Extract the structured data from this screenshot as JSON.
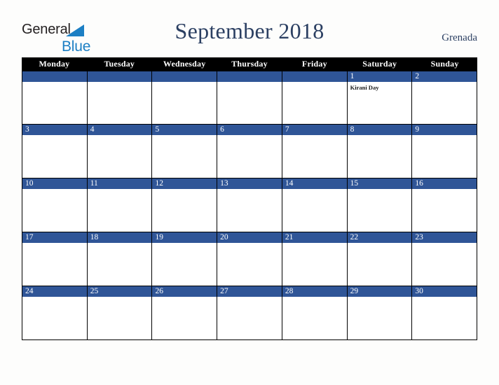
{
  "brand": {
    "name_part1": "General",
    "name_part2": "Blue",
    "triangle_icon": "triangle-icon",
    "primary_color": "#1c7fc4",
    "text_color": "#231f20"
  },
  "header": {
    "title": "September 2018",
    "locale": "Grenada",
    "title_color": "#2b3f62"
  },
  "calendar": {
    "accent_color": "#2f5597",
    "header_bg": "#000000",
    "cell_bg": "#ffffff",
    "day_headers": [
      "Monday",
      "Tuesday",
      "Wednesday",
      "Thursday",
      "Friday",
      "Saturday",
      "Sunday"
    ],
    "weeks": [
      {
        "days": [
          {
            "num": "",
            "events": []
          },
          {
            "num": "",
            "events": []
          },
          {
            "num": "",
            "events": []
          },
          {
            "num": "",
            "events": []
          },
          {
            "num": "",
            "events": []
          },
          {
            "num": "1",
            "events": [
              "Kirani Day"
            ]
          },
          {
            "num": "2",
            "events": []
          }
        ]
      },
      {
        "days": [
          {
            "num": "3",
            "events": []
          },
          {
            "num": "4",
            "events": []
          },
          {
            "num": "5",
            "events": []
          },
          {
            "num": "6",
            "events": []
          },
          {
            "num": "7",
            "events": []
          },
          {
            "num": "8",
            "events": []
          },
          {
            "num": "9",
            "events": []
          }
        ]
      },
      {
        "days": [
          {
            "num": "10",
            "events": []
          },
          {
            "num": "11",
            "events": []
          },
          {
            "num": "12",
            "events": []
          },
          {
            "num": "13",
            "events": []
          },
          {
            "num": "14",
            "events": []
          },
          {
            "num": "15",
            "events": []
          },
          {
            "num": "16",
            "events": []
          }
        ]
      },
      {
        "days": [
          {
            "num": "17",
            "events": []
          },
          {
            "num": "18",
            "events": []
          },
          {
            "num": "19",
            "events": []
          },
          {
            "num": "20",
            "events": []
          },
          {
            "num": "21",
            "events": []
          },
          {
            "num": "22",
            "events": []
          },
          {
            "num": "23",
            "events": []
          }
        ]
      },
      {
        "days": [
          {
            "num": "24",
            "events": []
          },
          {
            "num": "25",
            "events": []
          },
          {
            "num": "26",
            "events": []
          },
          {
            "num": "27",
            "events": []
          },
          {
            "num": "28",
            "events": []
          },
          {
            "num": "29",
            "events": []
          },
          {
            "num": "30",
            "events": []
          }
        ]
      }
    ]
  }
}
